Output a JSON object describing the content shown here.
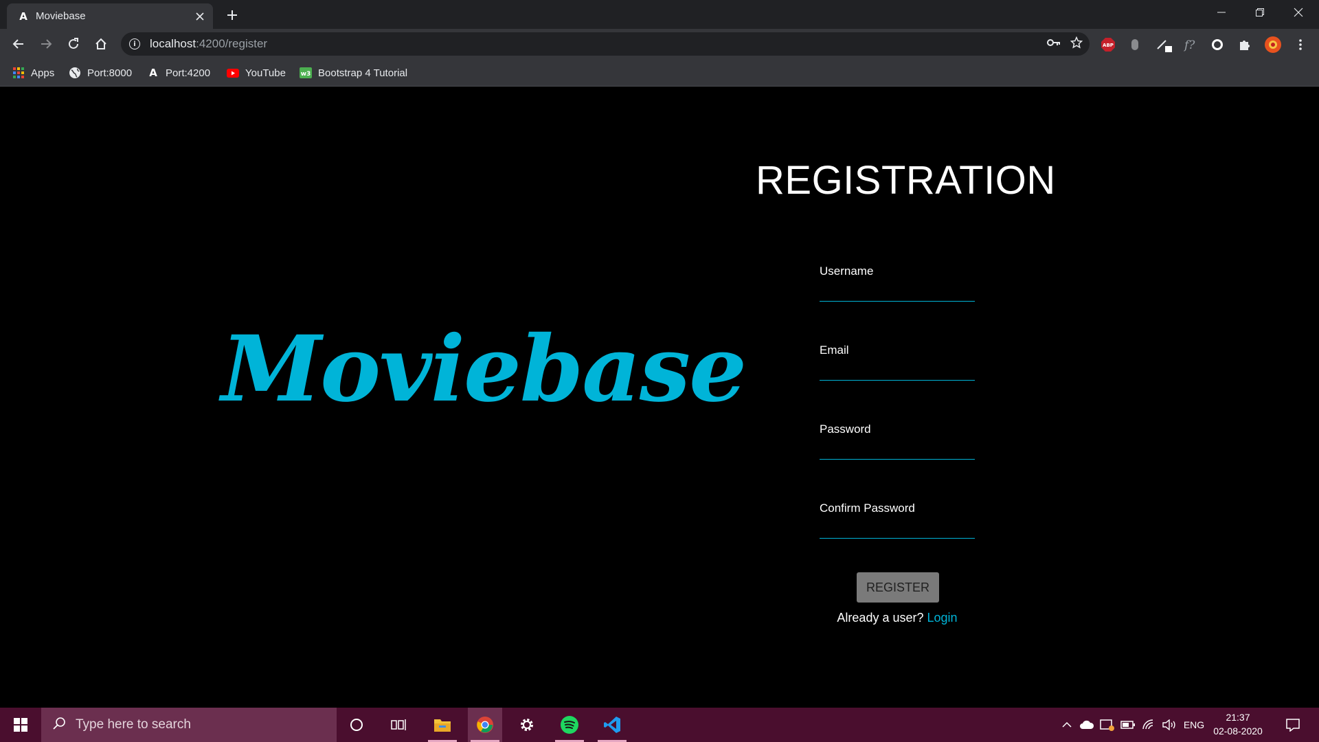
{
  "browser": {
    "tab": {
      "title": "Moviebase",
      "favicon": "angular-icon"
    },
    "url": {
      "host": "localhost",
      "path": ":4200/register"
    },
    "bookmarks": [
      {
        "label": "Apps",
        "icon": "apps-grid-icon"
      },
      {
        "label": "Port:8000",
        "icon": "globe-icon"
      },
      {
        "label": "Port:4200",
        "icon": "angular-icon"
      },
      {
        "label": "YouTube",
        "icon": "youtube-icon"
      },
      {
        "label": "Bootstrap 4 Tutorial",
        "icon": "w3schools-icon"
      }
    ],
    "extensions": {
      "abp_label": "ABP"
    }
  },
  "page": {
    "logo_text": "Moviebase",
    "title": "REGISTRATION",
    "fields": {
      "username": {
        "label": "Username",
        "value": ""
      },
      "email": {
        "label": "Email",
        "value": ""
      },
      "password": {
        "label": "Password",
        "value": ""
      },
      "confirm_password": {
        "label": "Confirm Password",
        "value": ""
      }
    },
    "register_button": "REGISTER",
    "already_text": "Already a user?",
    "login_link": "Login",
    "accent_color": "#00b4d8"
  },
  "taskbar": {
    "search_placeholder": "Type here to search",
    "language": "ENG",
    "time": "21:37",
    "date": "02-08-2020"
  }
}
